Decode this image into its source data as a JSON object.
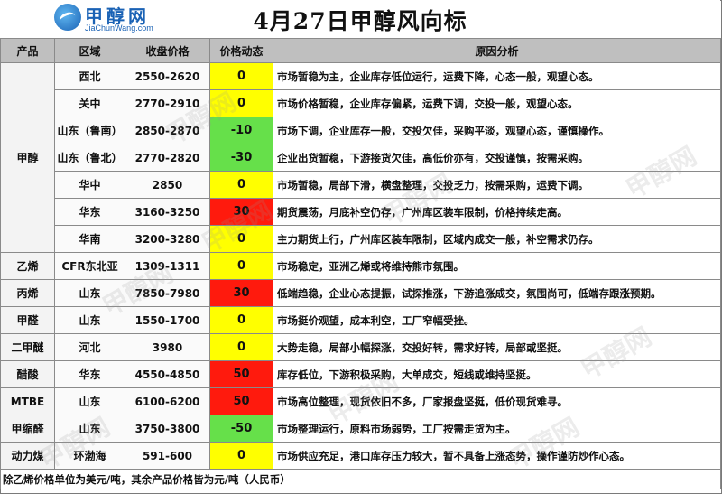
{
  "header": {
    "logo_text": "甲醇网",
    "logo_url": "JiaChunWang.com",
    "title": "4月27日甲醇风向标"
  },
  "columns": [
    "产品",
    "区域",
    "收盘价格",
    "价格动态",
    "原因分析"
  ],
  "colors": {
    "up": "#ff1a0d",
    "flat": "#ffff00",
    "down": "#66e04a",
    "header_bg": "#bfbfbf"
  },
  "rows": [
    {
      "region": "西北",
      "price": "2550-2620",
      "change": "0",
      "trend": "flat",
      "reason": "市场暂稳为主，企业库存低位运行，运费下降，心态一般，观望心态。"
    },
    {
      "region": "关中",
      "price": "2770-2910",
      "change": "0",
      "trend": "flat",
      "reason": "市场价格暂稳，企业库存偏紧，运费下调，交投一般，观望心态。"
    },
    {
      "region": "山东（鲁南）",
      "price": "2850-2870",
      "change": "-10",
      "trend": "down",
      "reason": "市场下调，企业库存一般，交投欠佳，采购平淡，观望心态，谨慎操作。"
    },
    {
      "region": "山东（鲁北）",
      "price": "2770-2820",
      "change": "-30",
      "trend": "down",
      "reason": "企业出货暂稳，下游接货欠佳，高低价亦有，交投谨慎，按需采购。"
    },
    {
      "region": "华中",
      "price": "2850",
      "change": "0",
      "trend": "flat",
      "reason": "市场暂稳，局部下滑，横盘整理，交投乏力，按需采购，运费下调。"
    },
    {
      "region": "华东",
      "price": "3160-3250",
      "change": "30",
      "trend": "up",
      "reason": "期货震荡，月底补空仍存，广州库区装车限制，价格持续走高。"
    },
    {
      "region": "华南",
      "price": "3200-3280",
      "change": "0",
      "trend": "flat",
      "reason": "主力期货上行，广州库区装车限制，区域内成交一般，补空需求仍存。"
    },
    {
      "product": "乙烯",
      "region": "CFR东北亚",
      "price": "1309-1311",
      "change": "0",
      "trend": "flat",
      "reason": "市场稳定，亚洲乙烯或将维持熊市氛围。"
    },
    {
      "product": "丙烯",
      "region": "山东",
      "price": "7850-7980",
      "change": "30",
      "trend": "up",
      "reason": "低端趋稳，企业心态提振，试探推涨，下游追涨成交，氛围尚可，低端存跟涨预期。"
    },
    {
      "product": "甲醛",
      "region": "山东",
      "price": "1550-1700",
      "change": "0",
      "trend": "flat",
      "reason": "市场挺价观望，成本利空，工厂窄幅受挫。"
    },
    {
      "product": "二甲醚",
      "region": "河北",
      "price": "3980",
      "change": "0",
      "trend": "flat",
      "reason": "大势走稳，局部小幅探涨，交投好转，需求好转，局部或坚挺。"
    },
    {
      "product": "醋酸",
      "region": "华东",
      "price": "4550-4850",
      "change": "50",
      "trend": "up",
      "reason": "库存低位，下游积极采购，大单成交，短线或维持坚挺。"
    },
    {
      "product": "MTBE",
      "region": "山东",
      "price": "6100-6200",
      "change": "50",
      "trend": "up",
      "reason": "市场高位整理，现货依旧不多，厂家报盘坚挺，低价现货难寻。"
    },
    {
      "product": "甲缩醛",
      "region": "山东",
      "price": "3750-3800",
      "change": "-50",
      "trend": "down",
      "reason": "市场整理运行，原料市场弱势，工厂按需走货为主。"
    },
    {
      "product": "动力煤",
      "region": "环渤海",
      "price": "591-600",
      "change": "0",
      "trend": "flat",
      "reason": "市场供应充足，港口库存压力较大，暂不具备上涨态势，操作谨防炒作心态。"
    }
  ],
  "group_product": "甲醇",
  "footer": "除乙烯价格单位为美元/吨，其余产品价格皆为元/吨（人民币）",
  "watermark": "甲醇网"
}
